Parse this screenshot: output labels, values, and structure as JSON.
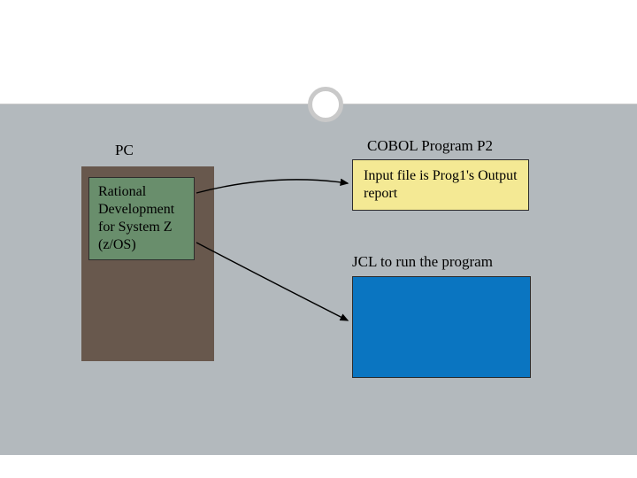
{
  "labels": {
    "pc": "PC",
    "rational": "Rational Development for System Z (z/OS)",
    "cobol_heading": "COBOL Program P2",
    "input_file": "Input file is Prog1's Output report",
    "jcl_heading": "JCL to run the program"
  },
  "colors": {
    "body_bg": "#b3b9bd",
    "pc_box": "#68584d",
    "green_box": "#698e6c",
    "yellow_box": "#f4e994",
    "blue_box": "#0a75c1",
    "ring": "#c9c9c9"
  }
}
